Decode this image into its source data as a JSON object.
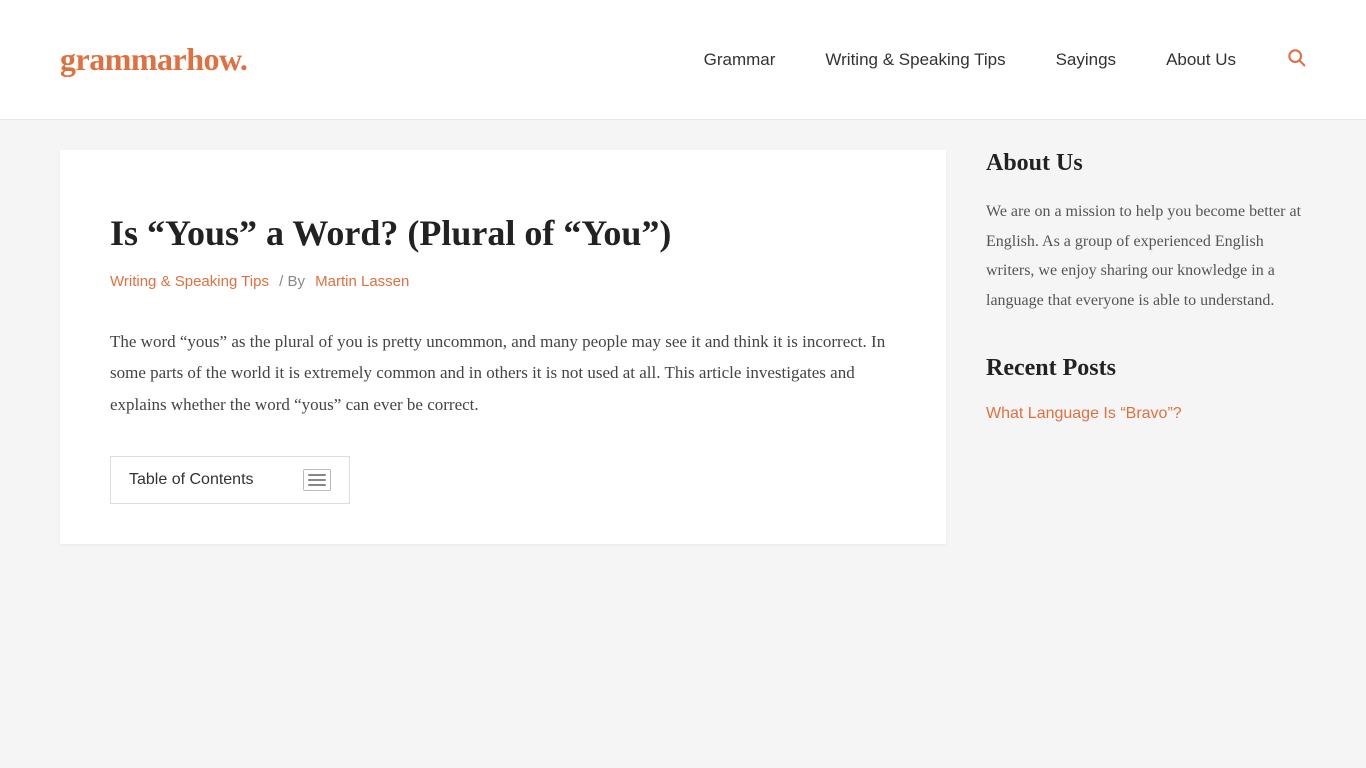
{
  "header": {
    "logo_text": "grammarhow",
    "logo_dot": ".",
    "nav_items": [
      {
        "label": "Grammar",
        "id": "grammar"
      },
      {
        "label": "Writing & Speaking Tips",
        "id": "writing-speaking-tips"
      },
      {
        "label": "Sayings",
        "id": "sayings"
      },
      {
        "label": "About Us",
        "id": "about-us"
      }
    ],
    "search_icon_label": "search"
  },
  "article": {
    "title": "Is “Yous” a Word? (Plural of “You”)",
    "meta": {
      "category": "Writing & Speaking Tips",
      "separator": "/ By",
      "author": "Martin Lassen"
    },
    "intro": "The word “yous” as the plural of you is pretty uncommon, and many people may see it and think it is incorrect. In some parts of the world it is extremely common and in others it is not used at all. This article investigates and explains whether the word “yous” can ever be correct.",
    "toc": {
      "label": "Table of Contents",
      "toggle_aria": "toggle table of contents"
    }
  },
  "sidebar": {
    "about_us": {
      "heading": "About Us",
      "text": "We are on a mission to help you become better at English. As a group of experienced English writers, we enjoy sharing our knowledge in a language that everyone is able to understand."
    },
    "recent_posts": {
      "heading": "Recent Posts",
      "items": [
        {
          "label": "What Language Is “Bravo”?"
        }
      ]
    }
  }
}
